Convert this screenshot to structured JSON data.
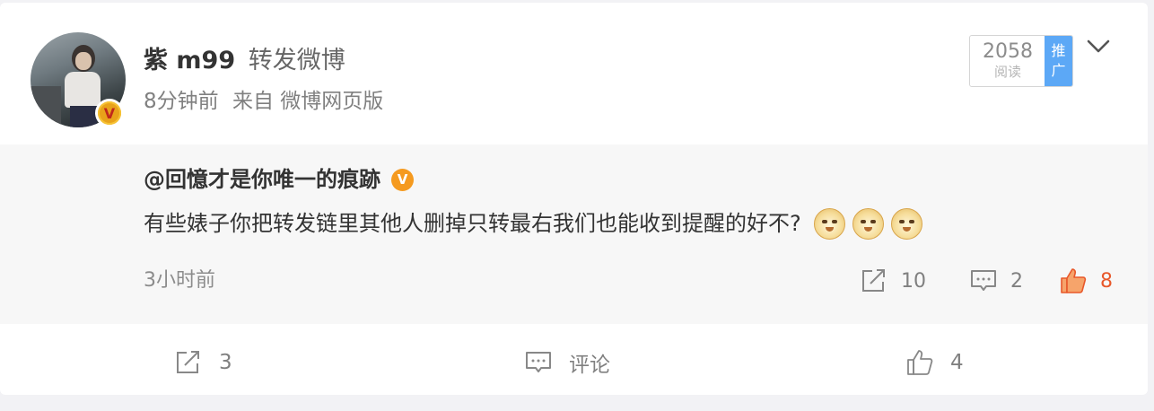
{
  "post": {
    "username": "紫 m99",
    "action": "转发微博",
    "time": "8分钟前",
    "source": "来自 微博网页版",
    "verified_badge": "V",
    "read_count": "2058",
    "read_label": "阅读",
    "promo_label_1": "推",
    "promo_label_2": "广"
  },
  "repost": {
    "author": "@回憶才是你唯一的痕跡",
    "verified_badge": "V",
    "text": "有些婊子你把转发链里其他人删掉只转最右我们也能收到提醒的好不?",
    "emoji_count": 3,
    "time": "3小时前",
    "forward_count": "10",
    "comment_count": "2",
    "like_count": "8"
  },
  "footer": {
    "forward_count": "3",
    "comment_label": "评论",
    "like_count": "4"
  },
  "colors": {
    "accent_like": "#e8582a",
    "promo_blue": "#5ca8f6",
    "verified_orange": "#f59a1f"
  }
}
